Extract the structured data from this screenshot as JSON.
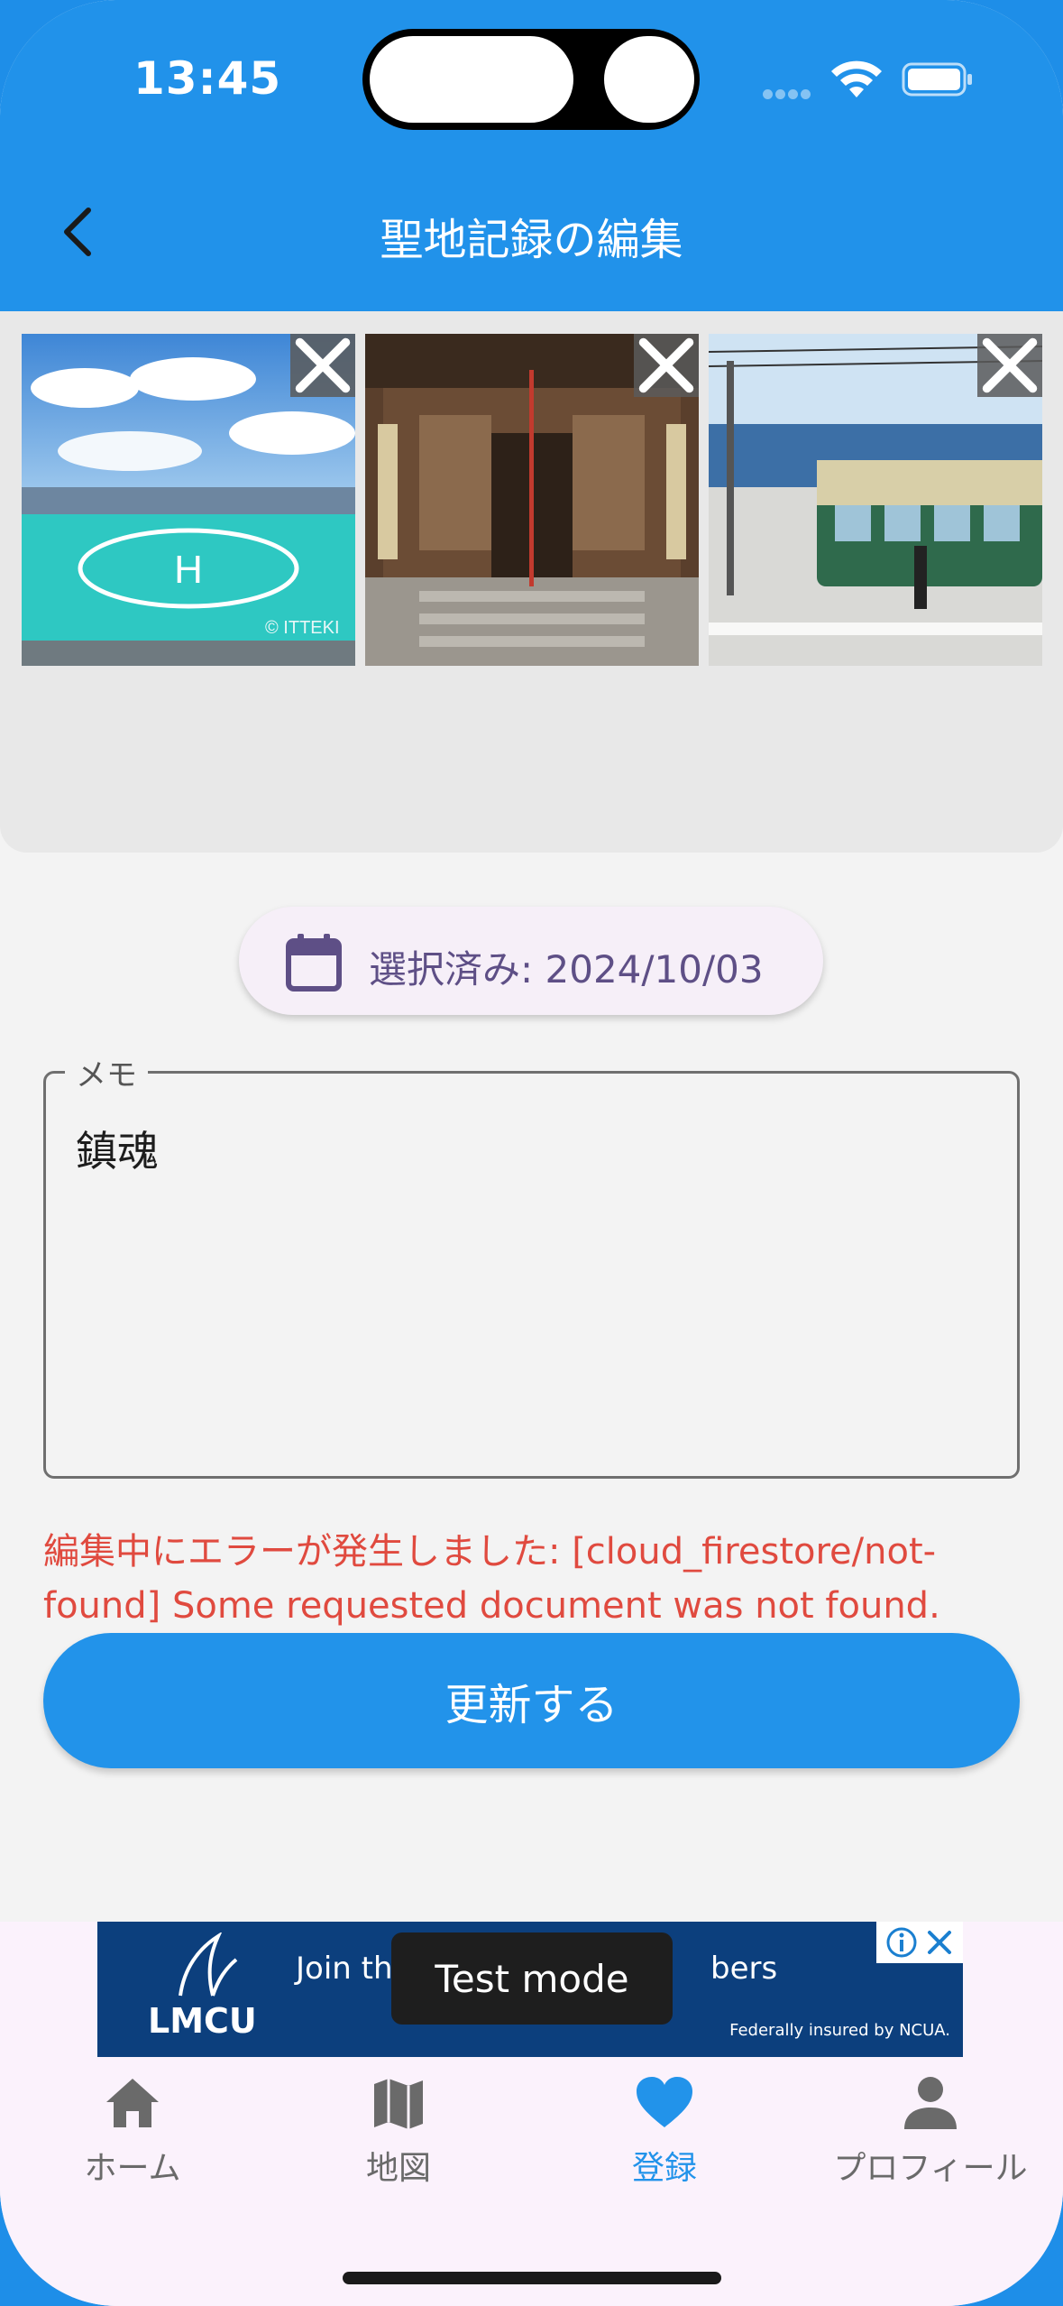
{
  "status_bar": {
    "time": "13:45",
    "icons": [
      "signal-dots-icon",
      "wifi-icon",
      "battery-icon"
    ]
  },
  "app_bar": {
    "title": "聖地記録の編集",
    "back_icon": "chevron-left-icon",
    "color": "#2192ea"
  },
  "photos": [
    {
      "name": "rooftop-helipad-photo",
      "watermark": "© ITTEKI",
      "remove_icon": "close-icon"
    },
    {
      "name": "temple-hall-photo",
      "remove_icon": "close-icon"
    },
    {
      "name": "seaside-train-photo",
      "remove_icon": "close-icon"
    }
  ],
  "date_chip": {
    "icon": "calendar-icon",
    "label": "選択済み: 2024/10/03"
  },
  "memo": {
    "label": "メモ",
    "value": "鎮魂"
  },
  "error_message": "編集中にエラーが発生しました: [cloud_firestore/not-found] Some requested document was not found.",
  "update_button": {
    "label": "更新する"
  },
  "ad": {
    "logo": "LMCU",
    "headline_start": "Join th",
    "headline_end": "bers",
    "fine_print": "Federally insured by NCUA.",
    "test_mode": "Test mode",
    "icons": [
      "info-icon",
      "close-icon"
    ]
  },
  "bottom_nav": [
    {
      "label": "ホーム",
      "icon": "home-icon",
      "active": false
    },
    {
      "label": "地図",
      "icon": "map-icon",
      "active": false
    },
    {
      "label": "登録",
      "icon": "heart-icon",
      "active": true
    },
    {
      "label": "プロフィール",
      "icon": "person-icon",
      "active": false
    }
  ],
  "colors": {
    "primary": "#2192ea",
    "error": "#e04a3f",
    "chip_text": "#5e4f86",
    "nav_inactive": "#6a6a6a"
  }
}
